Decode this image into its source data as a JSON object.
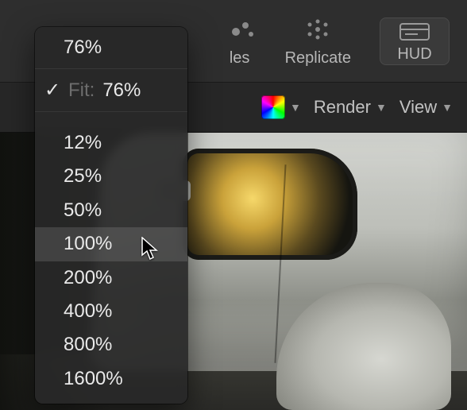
{
  "toolbar": {
    "particles_label": "les",
    "replicate_label": "Replicate",
    "hud_label": "HUD"
  },
  "subbar": {
    "render_label": "Render",
    "view_label": "View"
  },
  "zoom_menu": {
    "current": "76%",
    "fit_label": "Fit:",
    "fit_value": "76%",
    "checkmark": "✓",
    "options": [
      "12%",
      "25%",
      "50%",
      "100%",
      "200%",
      "400%",
      "800%",
      "1600%"
    ],
    "hover_index": 3
  }
}
